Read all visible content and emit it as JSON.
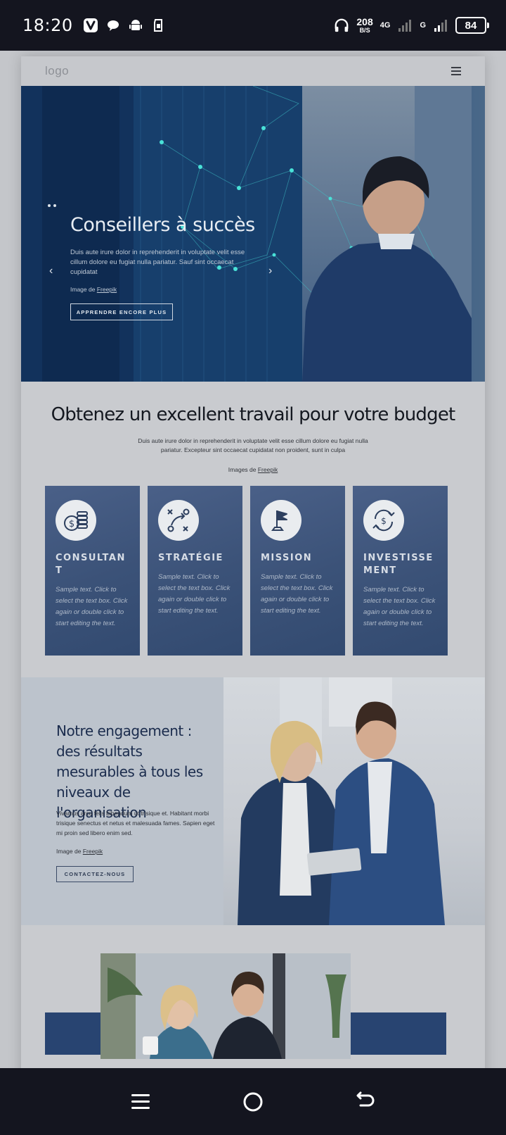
{
  "status_bar": {
    "time": "18:20",
    "speed_value": "208",
    "speed_unit": "B/S",
    "network_1": "4G",
    "network_2": "G",
    "battery": "84"
  },
  "site": {
    "logo": "logo"
  },
  "hero": {
    "title": "Conseillers à succès",
    "text": "Duis aute irure dolor in reprehenderit in voluptate velit esse cillum dolore eu fugiat nulla pariatur. Sauf sint occaecat cupidatat",
    "credit_prefix": "Image de ",
    "credit_link": "Freepik",
    "button": "APPRENDRE ENCORE PLUS"
  },
  "section2": {
    "title": "Obtenez un excellent travail pour votre budget",
    "text": "Duis aute irure dolor in reprehenderit in voluptate velit esse cillum dolore eu fugiat nulla pariatur. Excepteur sint occaecat cupidatat non proident, sunt in culpa",
    "credit_prefix": "Images de ",
    "credit_link": "Freepik",
    "cards": [
      {
        "title": "CONSULTANT",
        "text": "Sample text. Click to select the text box. Click again or double click to start editing the text.",
        "icon": "coins-icon"
      },
      {
        "title": "STRATÉGIE",
        "text": "Sample text. Click to select the text box. Click again or double click to start editing the text.",
        "icon": "strategy-icon"
      },
      {
        "title": "MISSION",
        "text": "Sample text. Click to select the text box. Click again or double click to start editing the text.",
        "icon": "flag-icon"
      },
      {
        "title": "INVESTISSEMENT",
        "text": "Sample text. Click to select the text box. Click again or double click to start editing the text.",
        "icon": "exchange-icon"
      }
    ]
  },
  "section3": {
    "title": "Notre engagement : des résultats mesurables à tous les niveaux de l'organisation",
    "text": "Vivamus arcu felis bibendum ut trisique et. Habitant morbi trisique senectus et netus et malesuada fames. Sapien eget mi proin sed libero enim sed.",
    "credit_prefix": "Image de ",
    "credit_link": "Freepik",
    "button": "CONTACTEZ-NOUS"
  }
}
